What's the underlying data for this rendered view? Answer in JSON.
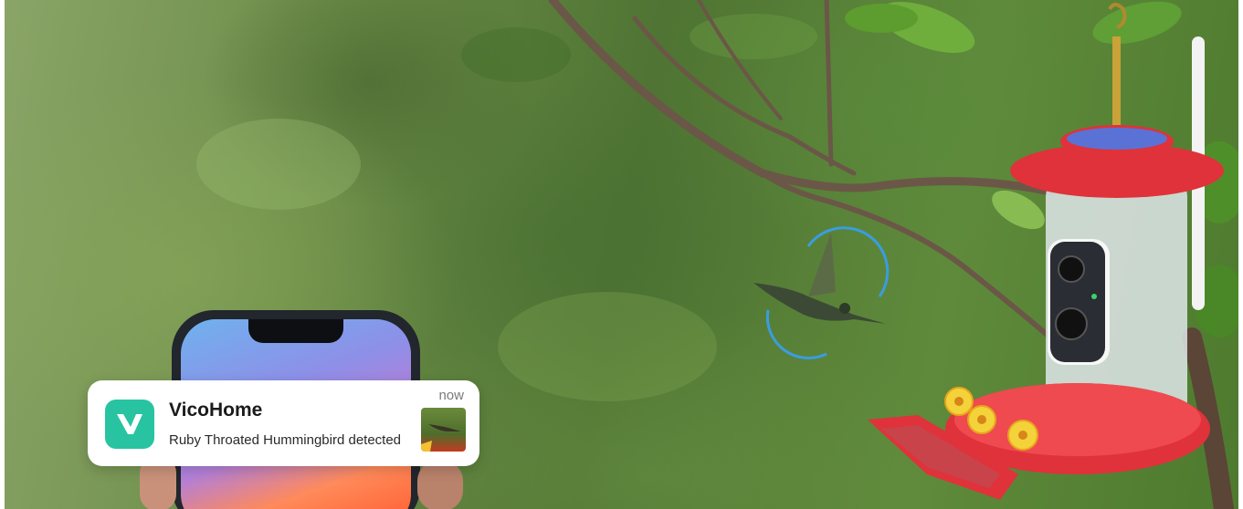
{
  "notification": {
    "app_name": "VicoHome",
    "message": "Ruby Throated Hummingbird detected",
    "time": "now"
  },
  "icons": {
    "app_icon": "vicohome-logo-icon",
    "thumbnail": "hummingbird-thumbnail"
  },
  "colors": {
    "brand": "#28c4a2",
    "feeder_red": "#e0323a",
    "foliage": "#5f8a3b"
  }
}
